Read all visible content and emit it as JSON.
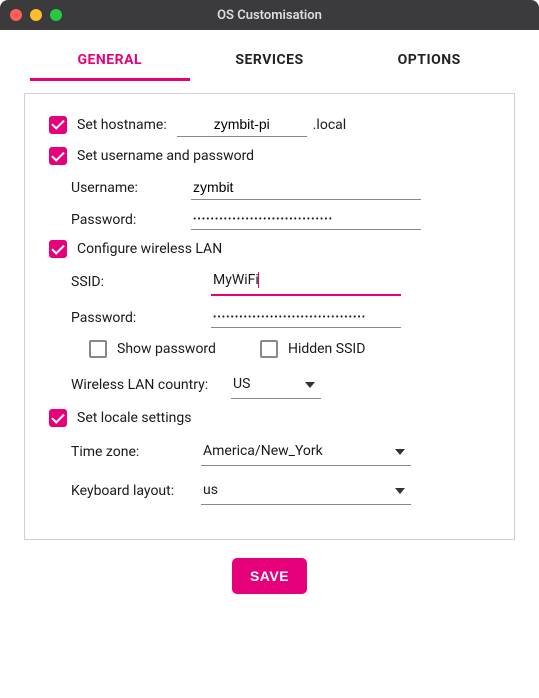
{
  "window": {
    "title": "OS Customisation"
  },
  "tabs": {
    "general": "GENERAL",
    "services": "SERVICES",
    "options": "OPTIONS"
  },
  "hostname": {
    "checkbox_label": "Set hostname:",
    "value": "zymbit-pi",
    "suffix": ".local"
  },
  "userpass": {
    "checkbox_label": "Set username and password",
    "username_label": "Username:",
    "username_value": "zymbit",
    "password_label": "Password:",
    "password_value": "••••••••••••••••••••••••••••••••"
  },
  "wifi": {
    "checkbox_label": "Configure wireless LAN",
    "ssid_label": "SSID:",
    "ssid_value": "MyWiFi",
    "password_label": "Password:",
    "password_value": "•••••••••••••••••••••••••••••••••••",
    "show_password_label": "Show password",
    "hidden_ssid_label": "Hidden SSID",
    "country_label": "Wireless LAN country:",
    "country_value": "US"
  },
  "locale": {
    "checkbox_label": "Set locale settings",
    "timezone_label": "Time zone:",
    "timezone_value": "America/New_York",
    "keyboard_label": "Keyboard layout:",
    "keyboard_value": "us"
  },
  "save_label": "SAVE"
}
